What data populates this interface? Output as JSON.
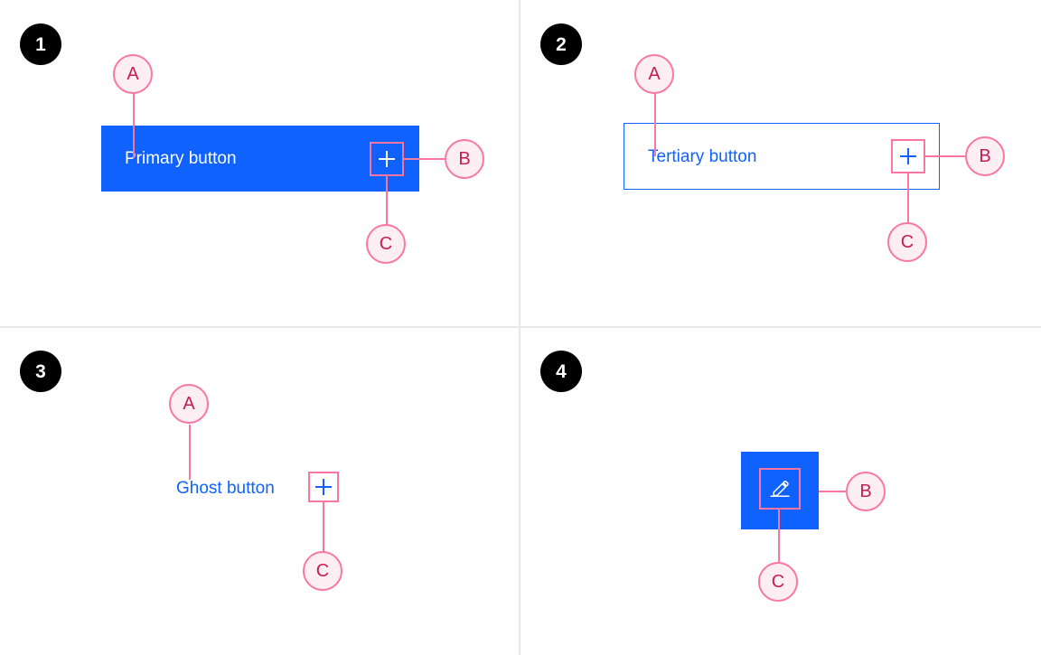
{
  "page": {
    "background": "#ffffff",
    "divider_color": "#e8e8e8",
    "accent_blue": "#0f62fe",
    "annotation_pink": "#fa77a4",
    "annotation_fill": "#fdeef3",
    "annotation_text": "#c31e55",
    "badge_background": "#000000"
  },
  "panels": [
    {
      "number": "1",
      "button": {
        "type": "primary",
        "label": "Primary button",
        "icon": "plus-icon",
        "icon_color": "#ffffff",
        "background": "#0f62fe",
        "text_color": "#ffffff"
      },
      "annotations": [
        {
          "id": "A",
          "target": "button-label"
        },
        {
          "id": "B",
          "target": "button-icon"
        },
        {
          "id": "C",
          "target": "icon-padding"
        }
      ]
    },
    {
      "number": "2",
      "button": {
        "type": "tertiary",
        "label": "Tertiary button",
        "icon": "plus-icon",
        "icon_color": "#0f62fe",
        "background": "#ffffff",
        "border_color": "#0f62fe",
        "text_color": "#0f62fe"
      },
      "annotations": [
        {
          "id": "A",
          "target": "button-label"
        },
        {
          "id": "B",
          "target": "button-icon"
        },
        {
          "id": "C",
          "target": "icon-padding"
        }
      ]
    },
    {
      "number": "3",
      "button": {
        "type": "ghost",
        "label": "Ghost button",
        "icon": "plus-icon",
        "icon_color": "#0f62fe",
        "background": "transparent",
        "text_color": "#0f62fe"
      },
      "annotations": [
        {
          "id": "A",
          "target": "button-label"
        },
        {
          "id": "C",
          "target": "icon-padding"
        }
      ]
    },
    {
      "number": "4",
      "button": {
        "type": "icon-only",
        "label": "",
        "icon": "pencil-icon",
        "icon_color": "#ffffff",
        "background": "#0f62fe"
      },
      "annotations": [
        {
          "id": "B",
          "target": "button-icon"
        },
        {
          "id": "C",
          "target": "icon-padding"
        }
      ]
    }
  ]
}
